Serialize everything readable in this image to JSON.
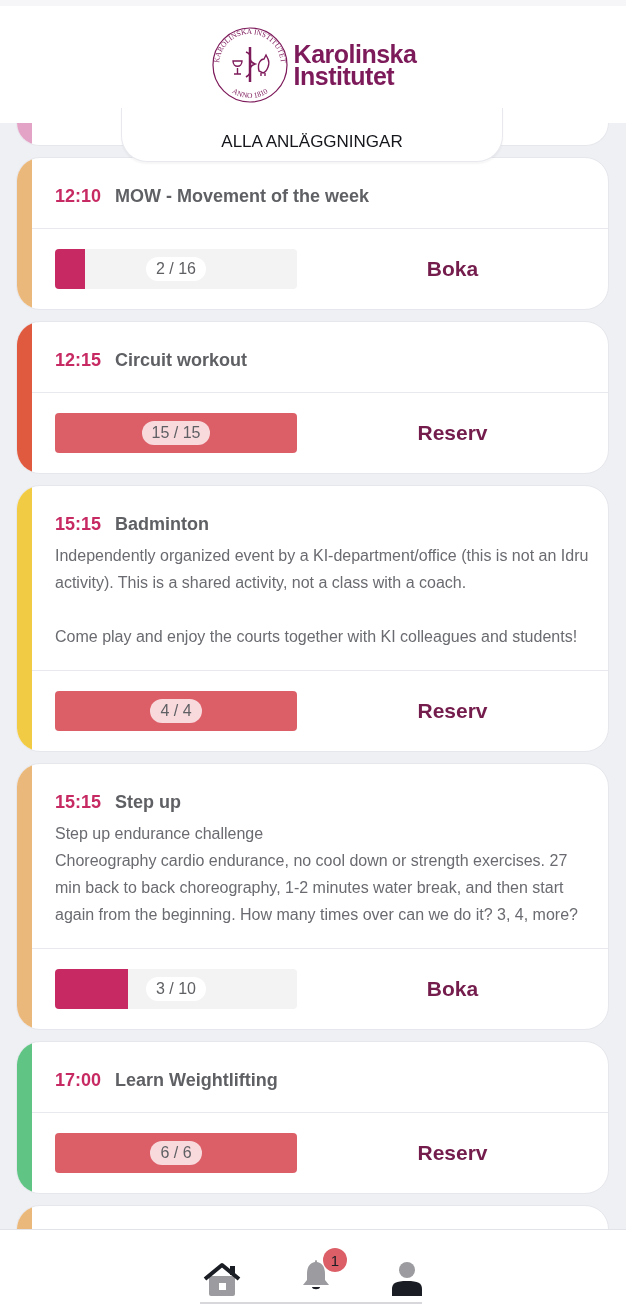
{
  "header": {
    "logo_text": [
      "Karolinska",
      "Institutet"
    ],
    "seal_top": "KAROLINSKA INSTITUTET",
    "seal_bottom": "ANNO 1810",
    "facility_filter": "ALLA ANLÄGGNINGAR"
  },
  "classes": [
    {
      "kind": "partial",
      "color": "#e3a3c6"
    },
    {
      "kind": "class",
      "color": "#ebb87c",
      "time": "12:10",
      "title": "MOW - Movement of the week",
      "count": "2 / 16",
      "level": 0.125,
      "action": "Boka"
    },
    {
      "kind": "class",
      "color": "#e05a3f",
      "time": "12:15",
      "title": "Circuit workout",
      "count": "15 / 15",
      "level": 1,
      "action": "Reserv"
    },
    {
      "kind": "class",
      "color": "#f2cb45",
      "time": "15:15",
      "title": "Badminton",
      "description": [
        "Independently organized event by a KI-department/office (this is not an Idru activity). This is a shared activity, not a class with a coach.",
        "Come play and enjoy the courts together with KI colleagues and students!"
      ],
      "count": "4 / 4",
      "level": 1,
      "action": "Reserv"
    },
    {
      "kind": "class",
      "color": "#ebb87c",
      "time": "15:15",
      "title": "Step up",
      "description": [
        "Step up endurance challenge\nChoreography cardio endurance, no cool down or strength exercises. 27 min back to back choreography, 1-2 minutes water break, and then start again from the beginning. How many times over can we do it? 3, 4, more?"
      ],
      "count": "3 / 10",
      "level": 0.3,
      "action": "Boka"
    },
    {
      "kind": "class",
      "color": "#5fc484",
      "time": "17:00",
      "title": "Learn Weightlifting",
      "count": "6 / 6",
      "level": 1,
      "action": "Reserv"
    },
    {
      "kind": "partial",
      "color": "#ebb87c"
    }
  ],
  "nav": {
    "notification_badge": "1"
  }
}
